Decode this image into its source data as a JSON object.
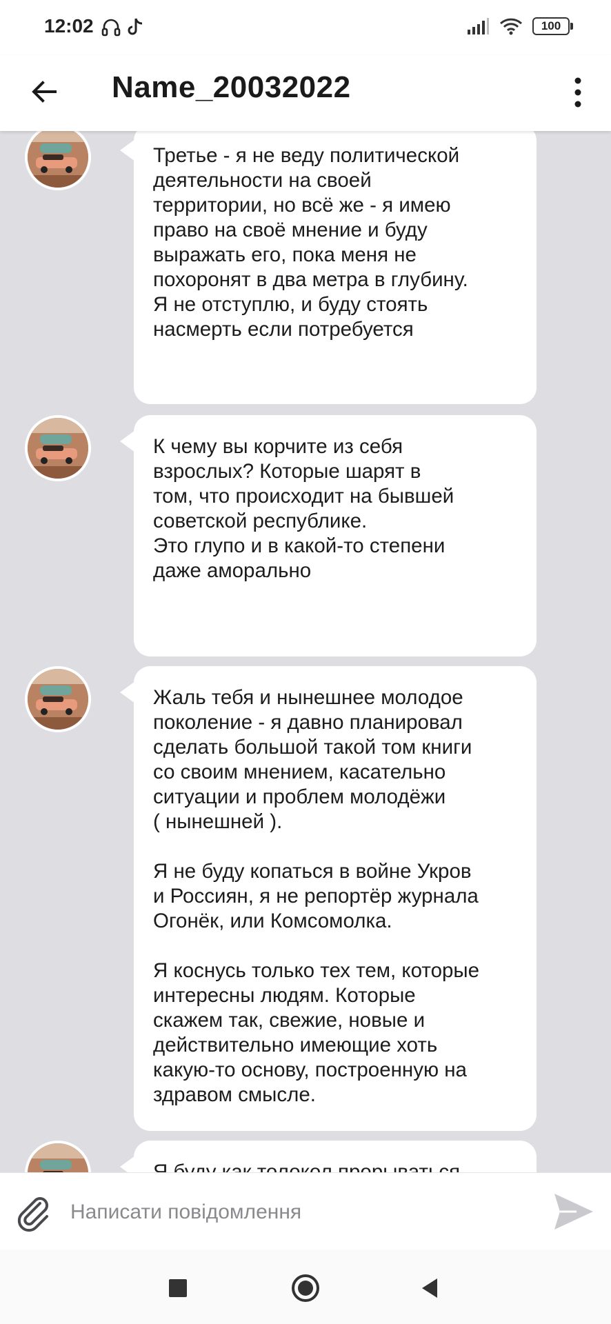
{
  "status_bar": {
    "time": "12:02",
    "battery": "100",
    "icons": [
      "headphones-icon",
      "tiktok-icon",
      "signal-icon",
      "wifi-icon",
      "battery-icon"
    ]
  },
  "header": {
    "title": "Name_20032022"
  },
  "messages": [
    {
      "text": "Третье - я не веду политической\nдеятельности на своей\nтерритории, но всё же - я имею\nправо на своё мнение и буду\nвыражать его, пока меня не\nпохоронят в два метра в глубину.\nЯ не отступлю, и буду стоять\nнасмерть если потребуется"
    },
    {
      "text": "К чему вы корчите из себя\nвзрослых? Которые шарят в\nтом, что происходит на бывшей\nсоветской республике.\nЭто глупо и в какой-то степени\nдаже аморально"
    },
    {
      "text": "Жаль тебя и нынешнее молодое\nпоколение - я давно планировал\nсделать большой такой том книги\nсо своим мнением, касательно\nситуации и проблем молодёжи\n( нынешней ).\n\nЯ не буду копаться в войне Укров\nи Россиян, я не репортёр журнала\nОгонёк, или Комсомолка.\n\nЯ коснусь только тех тем, которые\nинтересны людям. Которые\nскажем так, свежие, новые и\nдействительно имеющие хоть\nкакую-то основу, построенную на\nздравом смысле."
    },
    {
      "text": "Я буду как толокол прорываться"
    }
  ],
  "composer": {
    "placeholder": "Написати повідомлення"
  },
  "colors": {
    "chat_background": "#dedde2",
    "bubble": "#ffffff",
    "send_icon": "#c9c9ce"
  }
}
